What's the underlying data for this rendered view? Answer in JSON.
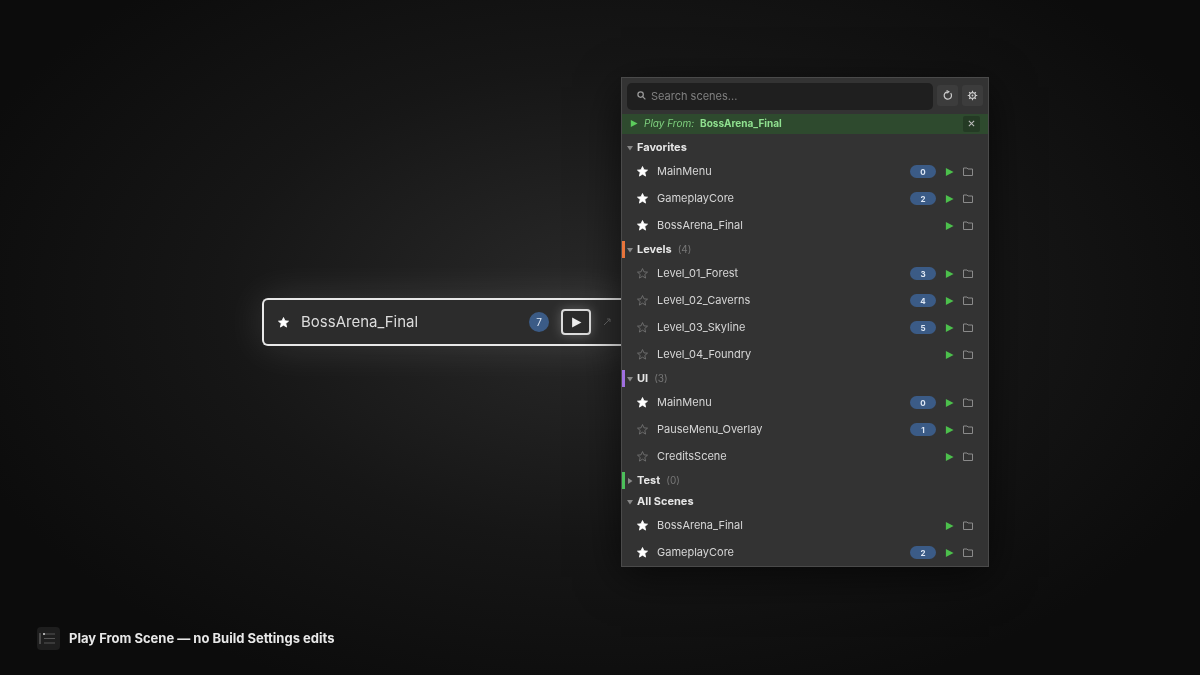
{
  "preview": {
    "starred": true,
    "name": "BossArena_Final",
    "badge": "7"
  },
  "panel": {
    "search": {
      "placeholder": "Search scenes..."
    },
    "play_from": {
      "label": "Play From:",
      "scene": "BossArena_Final"
    },
    "sections": [
      {
        "title": "Favorites",
        "expanded": true,
        "items": [
          {
            "starred": true,
            "name": "MainMenu",
            "badge": "0"
          },
          {
            "starred": true,
            "name": "GameplayCore",
            "badge": "2"
          },
          {
            "starred": true,
            "name": "BossArena_Final"
          }
        ]
      },
      {
        "title": "Levels",
        "count": "(4)",
        "color": "#e8743b",
        "expanded": true,
        "items": [
          {
            "starred": false,
            "name": "Level_01_Forest",
            "badge": "3"
          },
          {
            "starred": false,
            "name": "Level_02_Caverns",
            "badge": "4"
          },
          {
            "starred": false,
            "name": "Level_03_Skyline",
            "badge": "5"
          },
          {
            "starred": false,
            "name": "Level_04_Foundry"
          }
        ]
      },
      {
        "title": "UI",
        "count": "(3)",
        "color": "#a070e0",
        "expanded": true,
        "items": [
          {
            "starred": true,
            "name": "MainMenu",
            "badge": "0"
          },
          {
            "starred": false,
            "name": "PauseMenu_Overlay",
            "badge": "1"
          },
          {
            "starred": false,
            "name": "CreditsScene"
          }
        ]
      },
      {
        "title": "Test",
        "count": "(0)",
        "color": "#4cbf5a",
        "expanded": false
      },
      {
        "title": "All Scenes",
        "expanded": true,
        "items": [
          {
            "starred": true,
            "name": "BossArena_Final"
          },
          {
            "starred": true,
            "name": "GameplayCore",
            "badge": "2"
          }
        ]
      }
    ]
  },
  "caption": "Play From Scene — no Build Settings edits"
}
